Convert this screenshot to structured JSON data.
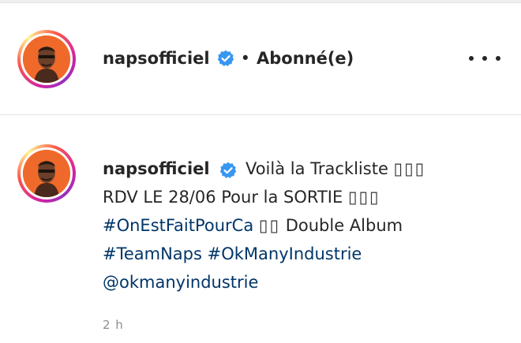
{
  "header": {
    "username": "napsofficiel",
    "separator": "•",
    "follow_state": "Abonné(e)",
    "verified_icon": "verified-badge-icon",
    "more_icon": "more-options-icon"
  },
  "comment": {
    "username": "napsofficiel",
    "line1_text": "Voilà la Trackliste",
    "line1_boxes": "▯▯▯",
    "line2_text": "RDV LE 28/06 Pour la SORTIE",
    "line2_boxes": "▯▯▯",
    "hashtag1": "#OnEstFaitPourCa",
    "line3_boxes": "▯▯",
    "line3_text": "Double Album",
    "hashtag2": "#TeamNaps",
    "hashtag3": "#OkManyIndustrie",
    "mention": "@okmanyindustrie",
    "timestamp": "2 h"
  },
  "colors": {
    "text": "#262626",
    "link": "#003569",
    "muted": "#8e8e8e",
    "verified": "#3897f0",
    "avatar_bg": "#ef6a2a"
  }
}
